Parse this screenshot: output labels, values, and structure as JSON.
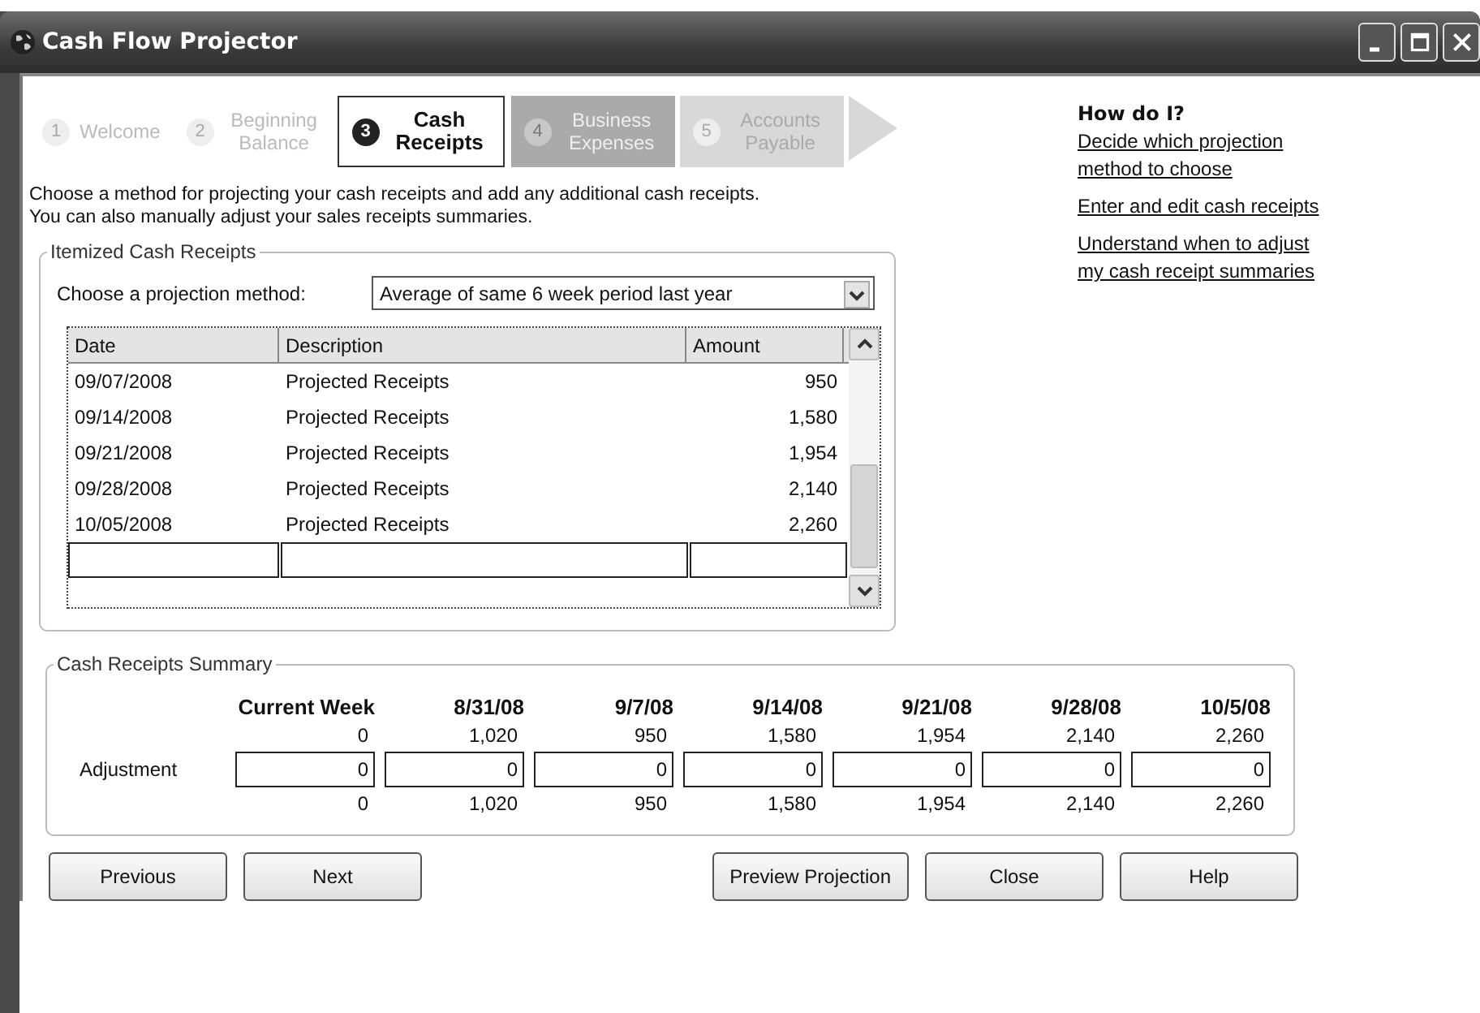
{
  "window": {
    "title": "Cash Flow Projector"
  },
  "steps": [
    {
      "number": "1",
      "label": "Welcome",
      "kind": "past",
      "selected": false
    },
    {
      "number": "2",
      "label": "Beginning Balance",
      "kind": "past",
      "selected": false
    },
    {
      "number": "3",
      "label": "Cash Receipts",
      "kind": "current",
      "selected": true
    },
    {
      "number": "4",
      "label": "Business Expenses",
      "kind": "next",
      "selected": false
    },
    {
      "number": "5",
      "label": "Accounts Payable",
      "kind": "later",
      "selected": false
    }
  ],
  "help": {
    "title": "How do I?",
    "links": [
      "Decide which projection method to choose",
      "Enter and edit cash receipts",
      "Understand when to adjust my cash receipt summaries"
    ]
  },
  "instructions": "Choose a method for projecting your cash receipts and add any additional cash receipts.\nYou can also manually adjust your sales receipts summaries.",
  "itemized": {
    "title": "Itemized Cash Receipts",
    "method_label": "Choose a projection method:",
    "method_value": "Average of same 6 week period last year",
    "columns": [
      "Date",
      "Description",
      "Amount"
    ],
    "rows": [
      [
        "09/07/2008",
        "Projected Receipts",
        "950"
      ],
      [
        "09/14/2008",
        "Projected Receipts",
        "1,580"
      ],
      [
        "09/21/2008",
        "Projected Receipts",
        "1,954"
      ],
      [
        "09/28/2008",
        "Projected Receipts",
        "2,140"
      ],
      [
        "10/05/2008",
        "Projected Receipts",
        "2,260"
      ]
    ]
  },
  "summary": {
    "title": "Cash Receipts Summary",
    "adjustment_label": "Adjustment",
    "columns": [
      {
        "heading": "Current Week",
        "projected": "0",
        "adjustment": "0",
        "total": "0"
      },
      {
        "heading": "8/31/08",
        "projected": "1,020",
        "adjustment": "0",
        "total": "1,020"
      },
      {
        "heading": "9/7/08",
        "projected": "950",
        "adjustment": "0",
        "total": "950"
      },
      {
        "heading": "9/14/08",
        "projected": "1,580",
        "adjustment": "0",
        "total": "1,580"
      },
      {
        "heading": "9/21/08",
        "projected": "1,954",
        "adjustment": "0",
        "total": "1,954"
      },
      {
        "heading": "9/28/08",
        "projected": "2,140",
        "adjustment": "0",
        "total": "2,140"
      },
      {
        "heading": "10/5/08",
        "projected": "2,260",
        "adjustment": "0",
        "total": "2,260"
      }
    ]
  },
  "buttons_left": [
    "Previous",
    "Next"
  ],
  "buttons_right": [
    "Preview Projection",
    "Close",
    "Help"
  ]
}
